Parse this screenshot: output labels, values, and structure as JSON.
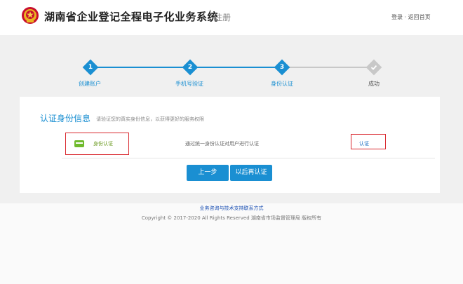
{
  "header": {
    "title": "湖南省企业登记全程电子化业务系统",
    "subtitle": "注册",
    "links": "登录 · 返回首页"
  },
  "steps": [
    {
      "number": "1",
      "label": "创建账户"
    },
    {
      "number": "2",
      "label": "手机号验证"
    },
    {
      "number": "3",
      "label": "身份认证"
    },
    {
      "number": "",
      "label": "成功"
    }
  ],
  "card": {
    "title": "认证身份信息",
    "hint": "请验证您的真实身份信息，以获得更好的服务权限",
    "verify_label": "身份认证",
    "verify_desc": "通过统一身份认证对用户进行认证",
    "action": "认证"
  },
  "buttons": {
    "prev": "上一步",
    "later": "以后再认证"
  },
  "footer": {
    "link": "业务咨询与技术支持联系方式",
    "copyright": "Copyright © 2017-2020 All Rights Reserved 湖南省市场监督管理局 版权所有"
  },
  "colors": {
    "primary": "#1a8fd2",
    "inactive": "#c8c8c8",
    "highlight": "#d9282e",
    "verify_green": "#6fba2c"
  }
}
